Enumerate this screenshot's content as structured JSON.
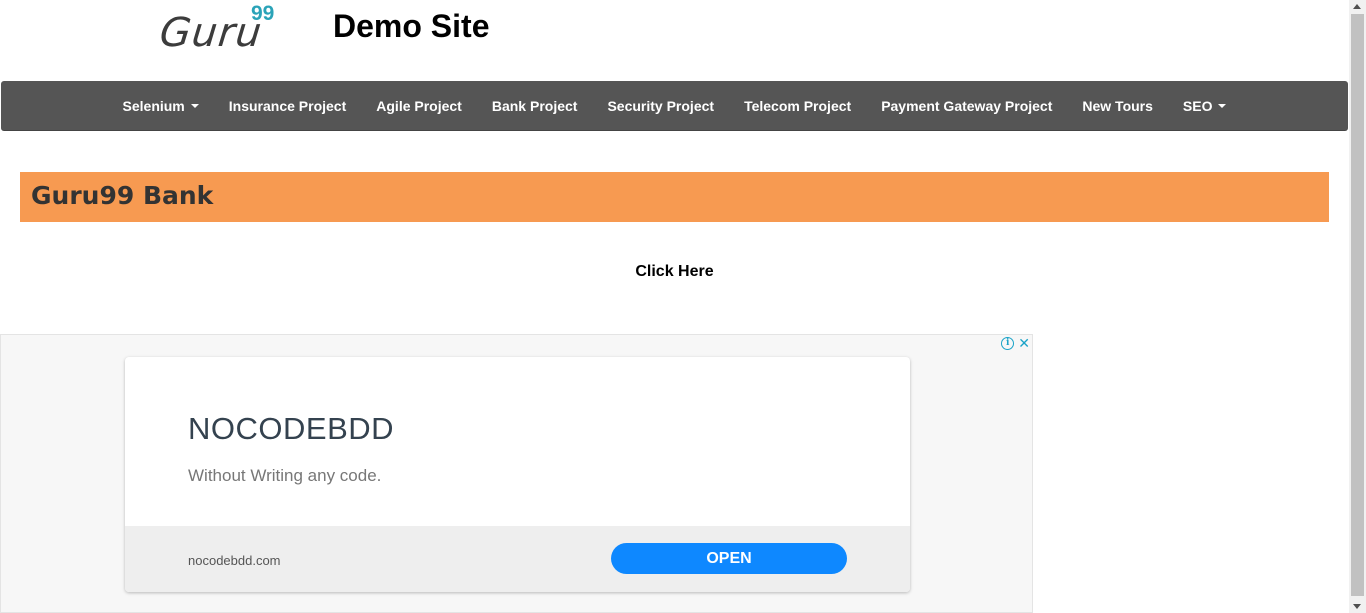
{
  "header": {
    "logo_text": "Guru",
    "logo_sup": "99",
    "site_title": "Demo Site"
  },
  "nav": {
    "items": [
      {
        "label": "Selenium",
        "dropdown": true
      },
      {
        "label": "Insurance Project",
        "dropdown": false
      },
      {
        "label": "Agile Project",
        "dropdown": false
      },
      {
        "label": "Bank Project",
        "dropdown": false
      },
      {
        "label": "Security Project",
        "dropdown": false
      },
      {
        "label": "Telecom Project",
        "dropdown": false
      },
      {
        "label": "Payment Gateway Project",
        "dropdown": false
      },
      {
        "label": "New Tours",
        "dropdown": false
      },
      {
        "label": "SEO",
        "dropdown": true
      }
    ]
  },
  "banner": {
    "title": "Guru99 Bank"
  },
  "main": {
    "click_here": "Click Here"
  },
  "ad": {
    "info_icon": "info-icon",
    "close_icon": "close-icon",
    "headline": "NOCODEBDD",
    "description": "Without Writing any code.",
    "url": "nocodebdd.com",
    "cta": "OPEN"
  },
  "colors": {
    "navbar_bg": "#555555",
    "banner_bg": "#f79a51",
    "logo_accent": "#2aa3b8",
    "cta_bg": "#0e88ff"
  }
}
